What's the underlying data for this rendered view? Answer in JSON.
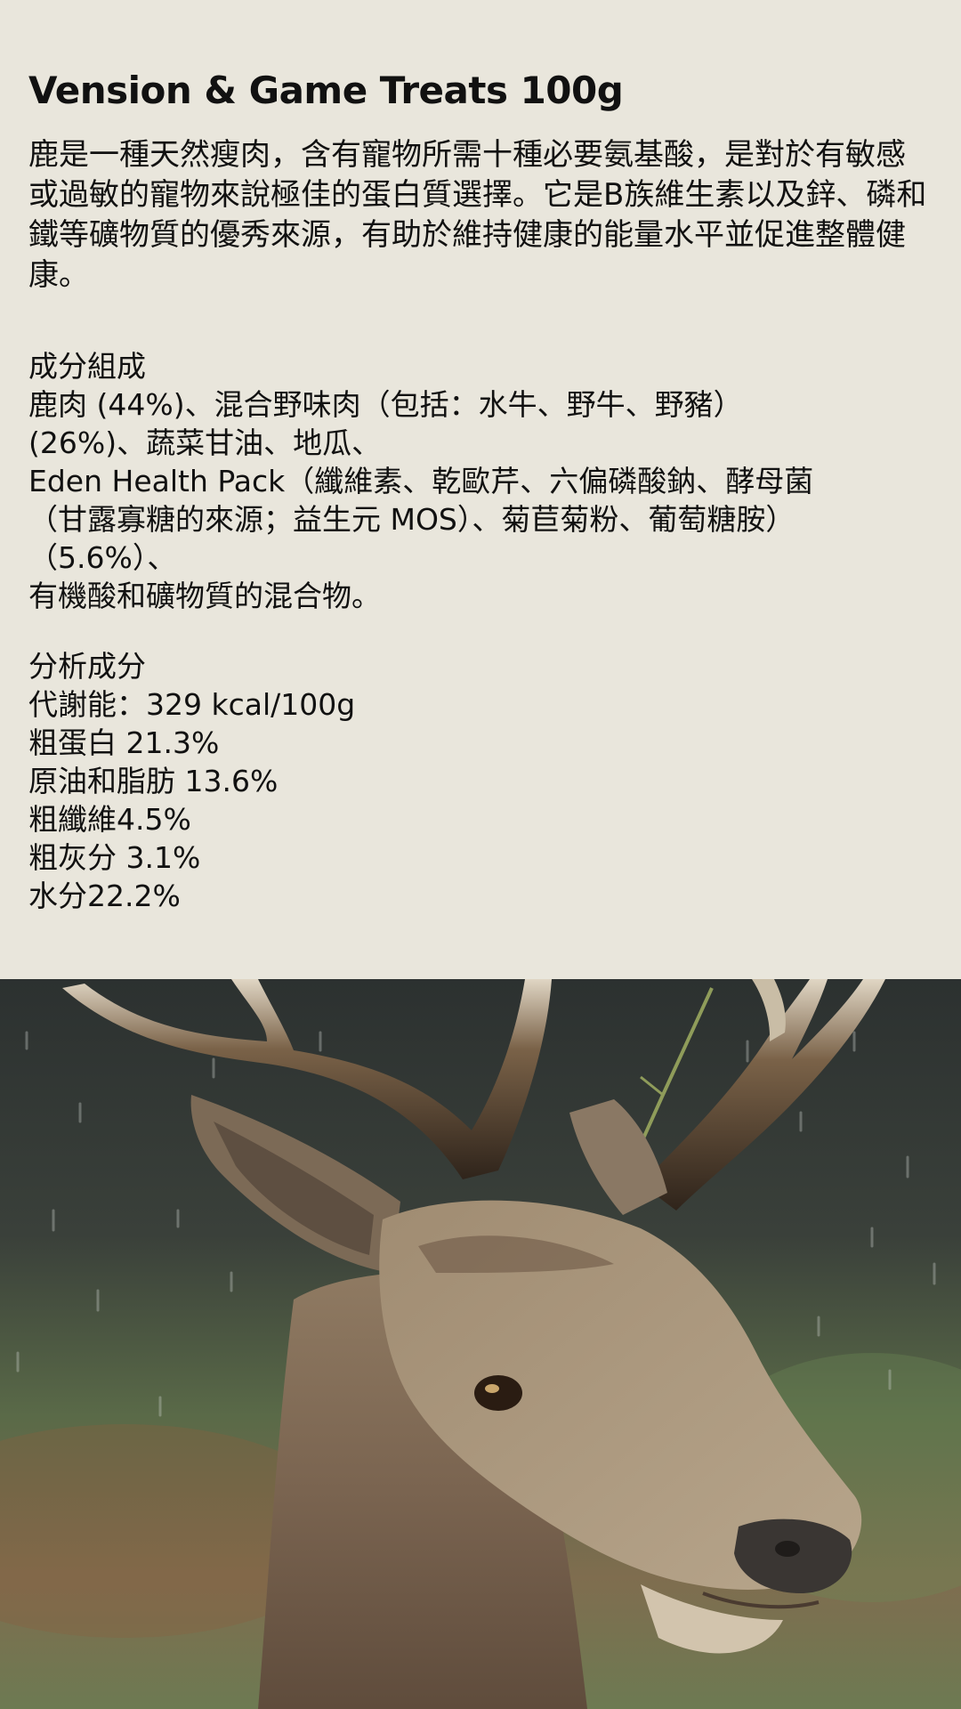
{
  "title": "Vension & Game Treats 100g",
  "description": "鹿是一種天然瘦肉，含有寵物所需十種必要氨基酸，是對於有敏感或過敏的寵物來說極佳的蛋白質選擇。它是B族維生素以及鋅、磷和鐵等礦物質的優秀來源，有助於維持健康的能量水平並促進整體健康。",
  "ingredients": {
    "heading": "成分組成",
    "lines": [
      "鹿肉 (44%)、混合野味肉（包括：水牛、野牛、野豬）",
      "(26%)、蔬菜甘油、地瓜、",
      "Eden Health Pack（纖維素、乾歐芹、六偏磷酸鈉、酵母菌",
      "（甘露寡糖的來源；益生元 MOS）、菊苣菊粉、葡萄糖胺）",
      "（5.6%）、",
      "有機酸和礦物質的混合物。"
    ]
  },
  "analysis": {
    "heading": "分析成分",
    "lines": [
      "代謝能：329 kcal/100g",
      "粗蛋白 21.3%",
      "原油和脂肪 13.6%",
      "粗纖維4.5%",
      "粗灰分 3.1%",
      "水分22.2%"
    ]
  },
  "photo": {
    "subject": "red-deer-stag"
  },
  "colors": {
    "background": "#e9e6dc",
    "text": "#111111"
  }
}
